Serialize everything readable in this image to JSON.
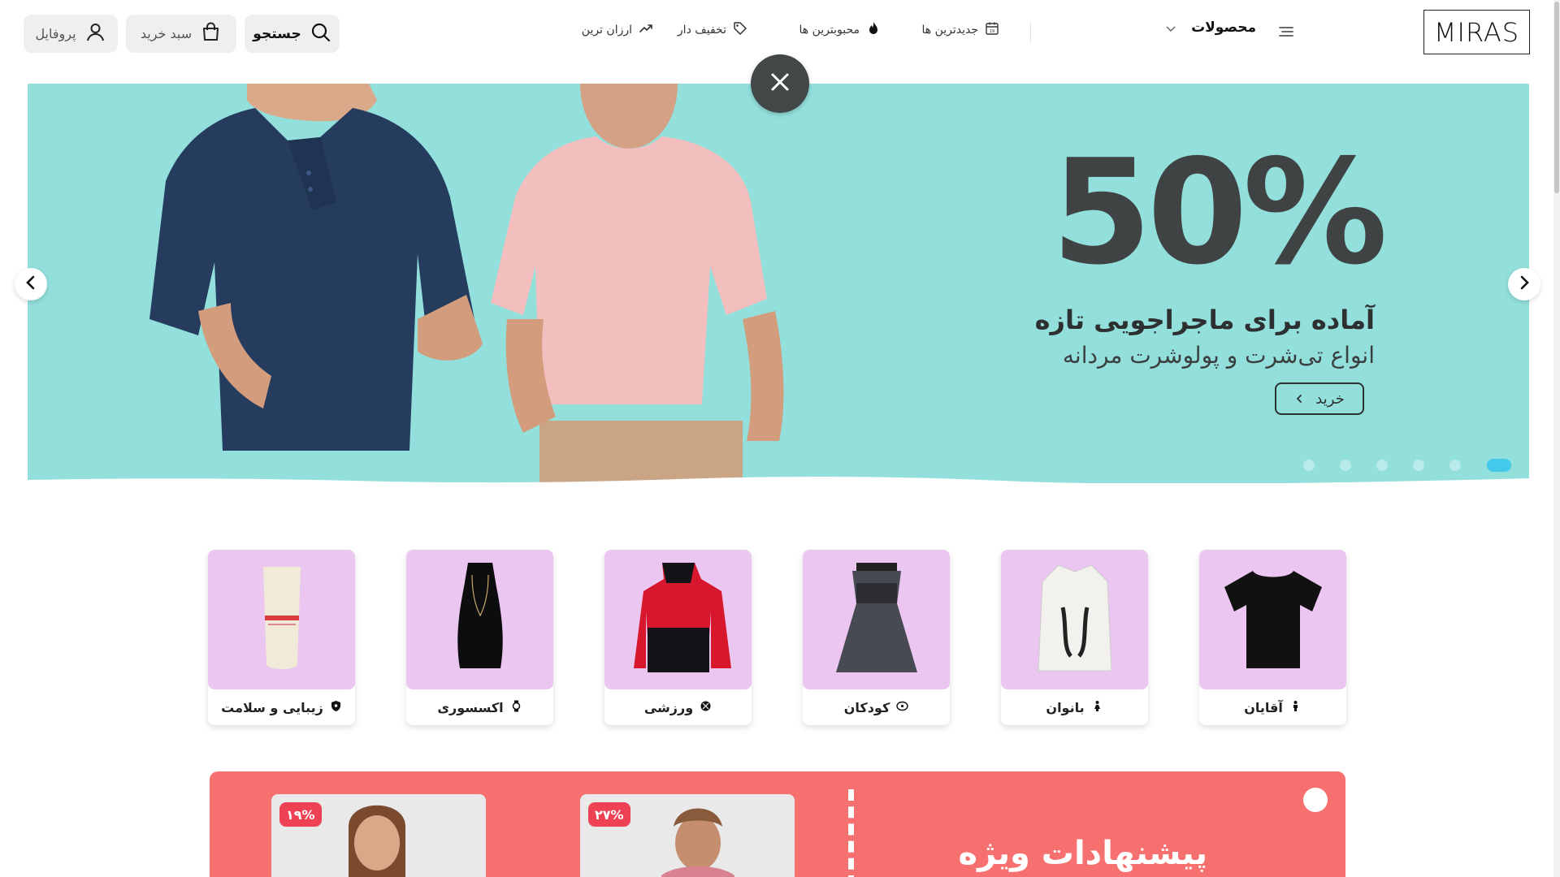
{
  "header": {
    "logo": "MIRAS",
    "products_label": "محصولات",
    "nav": [
      {
        "label": "جدیدترین ها",
        "icon": "calendar-icon"
      },
      {
        "label": "محبوبترین ها",
        "icon": "fire-icon"
      },
      {
        "label": "تخفیف دار",
        "icon": "tag-icon"
      },
      {
        "label": "ارزان ترین",
        "icon": "trend-icon"
      }
    ],
    "search_label": "جستجو",
    "cart_label": "سبد خرید",
    "profile_label": "پروفایل"
  },
  "hero": {
    "discount": "50%",
    "title": "آماده برای ماجراجویی تازه",
    "subtitle": "انواع تی‌شرت و پولوشرت مردانه",
    "button_label": "خرید",
    "slide_count": 6,
    "active_slide": 1,
    "bg_color": "#92dfdc"
  },
  "categories": [
    {
      "label": "آقایان",
      "icon": "male-icon"
    },
    {
      "label": "بانوان",
      "icon": "female-icon"
    },
    {
      "label": "کودکان",
      "icon": "child-face-icon"
    },
    {
      "label": "ورزشی",
      "icon": "ball-icon"
    },
    {
      "label": "اکسسوری",
      "icon": "watch-icon"
    },
    {
      "label": "زیبایی و سلامت",
      "icon": "shield-icon"
    }
  ],
  "offers": {
    "title": "پیشنهادات ویژه",
    "bg_color": "#f77070",
    "cards": [
      {
        "discount": "۲۷%"
      },
      {
        "discount": "۱۹%"
      }
    ]
  }
}
